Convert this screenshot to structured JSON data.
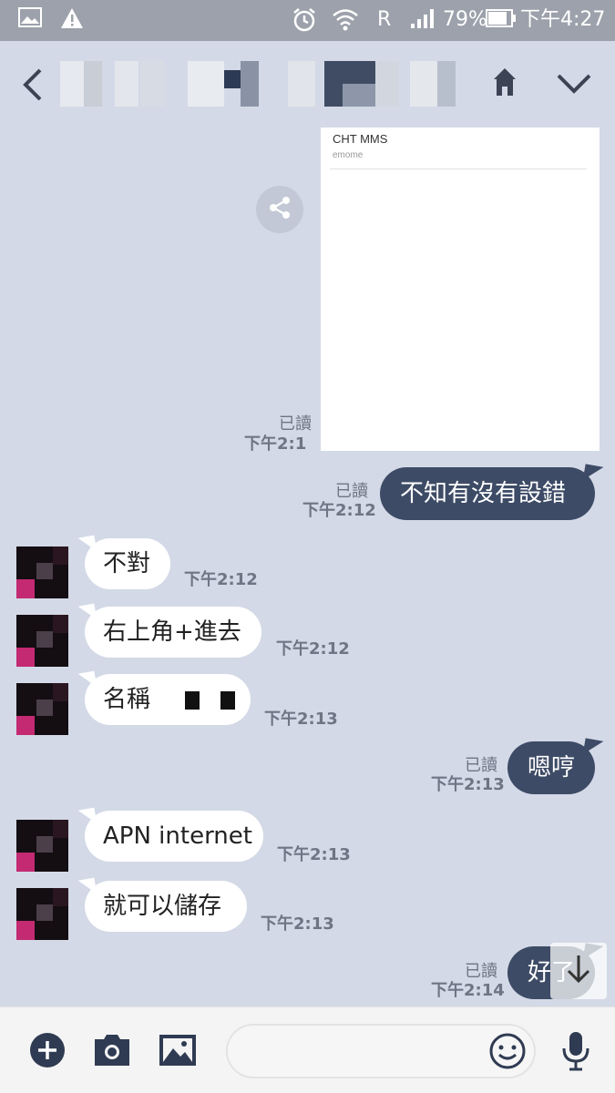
{
  "status_bar": {
    "carrier_flag": "R",
    "battery": "79%",
    "time": "下午4:27"
  },
  "header": {
    "back_icon": "chevron-left-icon",
    "home_icon": "home-icon",
    "menu_icon": "chevron-down-icon"
  },
  "mms_card": {
    "title": "CHT MMS",
    "subtitle": "emome",
    "read": "已讀",
    "time": "下午2:1"
  },
  "messages": [
    {
      "side": "out",
      "text": "不知有沒有設錯",
      "read": "已讀",
      "time": "下午2:12"
    },
    {
      "side": "in",
      "text": "不對",
      "time": "下午2:12"
    },
    {
      "side": "in",
      "text": "右上角+進去",
      "time": "下午2:12"
    },
    {
      "side": "in",
      "text": "名稱",
      "time": "下午2:13"
    },
    {
      "side": "out",
      "text": "嗯哼",
      "read": "已讀",
      "time": "下午2:13"
    },
    {
      "side": "in",
      "text": "APN internet",
      "time": "下午2:13"
    },
    {
      "side": "in",
      "text": "就可以儲存",
      "time": "下午2:13"
    },
    {
      "side": "out",
      "text": "好了",
      "read": "已讀",
      "time": "下午2:14"
    }
  ],
  "input_bar": {
    "placeholder": "",
    "icons": [
      "plus-icon",
      "camera-icon",
      "image-icon",
      "emoji-icon",
      "microphone-icon"
    ]
  },
  "colors": {
    "background": "#d3d9e6",
    "bubble_out": "#3d4b66",
    "bubble_in": "#ffffff",
    "status_bar": "#9ca1ab"
  }
}
